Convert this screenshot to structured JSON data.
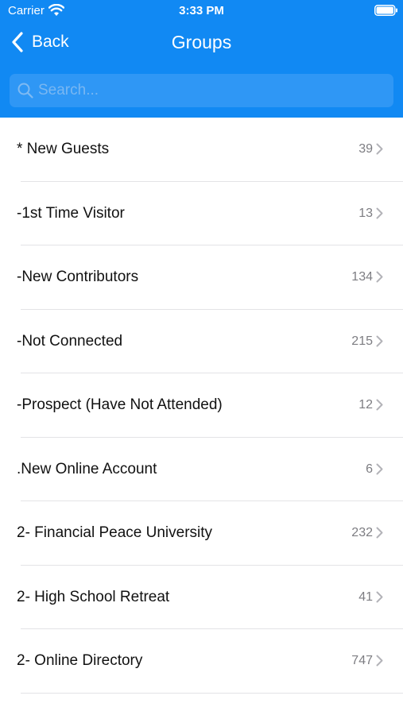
{
  "status_bar": {
    "carrier": "Carrier",
    "time": "3:33 PM"
  },
  "nav": {
    "back_label": "Back",
    "title": "Groups"
  },
  "search": {
    "placeholder": "Search..."
  },
  "colors": {
    "header_bg": "#1189f3",
    "search_bg": "#2f97f5",
    "count_text": "#7d7d82"
  },
  "groups": [
    {
      "name": "* New Guests",
      "count": "39"
    },
    {
      "name": "-1st Time Visitor",
      "count": "13"
    },
    {
      "name": "-New Contributors",
      "count": "134"
    },
    {
      "name": "-Not Connected",
      "count": "215"
    },
    {
      "name": "-Prospect (Have Not Attended)",
      "count": "12"
    },
    {
      "name": ".New Online Account",
      "count": "6"
    },
    {
      "name": "2- Financial Peace University",
      "count": "232"
    },
    {
      "name": "2- High School Retreat",
      "count": "41"
    },
    {
      "name": "2- Online Directory",
      "count": "747"
    }
  ]
}
